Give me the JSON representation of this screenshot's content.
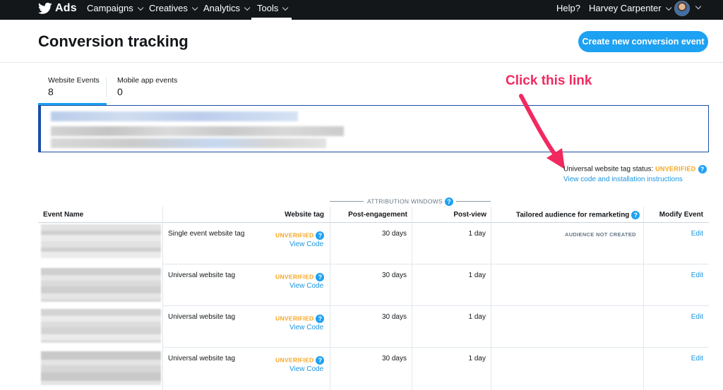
{
  "nav": {
    "brand": "Ads",
    "items": [
      {
        "label": "Campaigns"
      },
      {
        "label": "Creatives"
      },
      {
        "label": "Analytics"
      },
      {
        "label": "Tools"
      }
    ],
    "help": "Help?",
    "user": "Harvey Carpenter"
  },
  "header": {
    "title": "Conversion tracking",
    "create_button": "Create new conversion event"
  },
  "tabs": [
    {
      "label": "Website Events",
      "count": "8"
    },
    {
      "label": "Mobile app events",
      "count": "0"
    }
  ],
  "annotation": "Click this link",
  "tag_status": {
    "label": "Universal website tag status:",
    "value": "UNVERIFIED",
    "link": "View code and installation instructions"
  },
  "attribution_label": "ATTRIBUTION WINDOWS",
  "table": {
    "headers": {
      "event_name": "Event Name",
      "website_tag": "Website tag",
      "post_engagement": "Post-engagement",
      "post_view": "Post-view",
      "tailored": "Tailored audience for remarketing",
      "modify": "Modify Event"
    },
    "rows": [
      {
        "tag": "Single event website tag",
        "status": "UNVERIFIED",
        "view_code": "View Code",
        "post_engagement": "30 days",
        "post_view": "1 day",
        "audience": "AUDIENCE NOT CREATED",
        "edit": "Edit"
      },
      {
        "tag": "Universal website tag",
        "status": "UNVERIFIED",
        "view_code": "View Code",
        "post_engagement": "30 days",
        "post_view": "1 day",
        "audience": "",
        "edit": "Edit"
      },
      {
        "tag": "Universal website tag",
        "status": "UNVERIFIED",
        "view_code": "View Code",
        "post_engagement": "30 days",
        "post_view": "1 day",
        "audience": "",
        "edit": "Edit"
      },
      {
        "tag": "Universal website tag",
        "status": "UNVERIFIED",
        "view_code": "View Code",
        "post_engagement": "30 days",
        "post_view": "1 day",
        "audience": "",
        "edit": "Edit"
      }
    ]
  },
  "colors": {
    "nav_bg": "#14171a",
    "accent": "#1da1f2",
    "link": "#1b95e0",
    "warning": "#f5a623",
    "annotation": "#f2295f"
  }
}
